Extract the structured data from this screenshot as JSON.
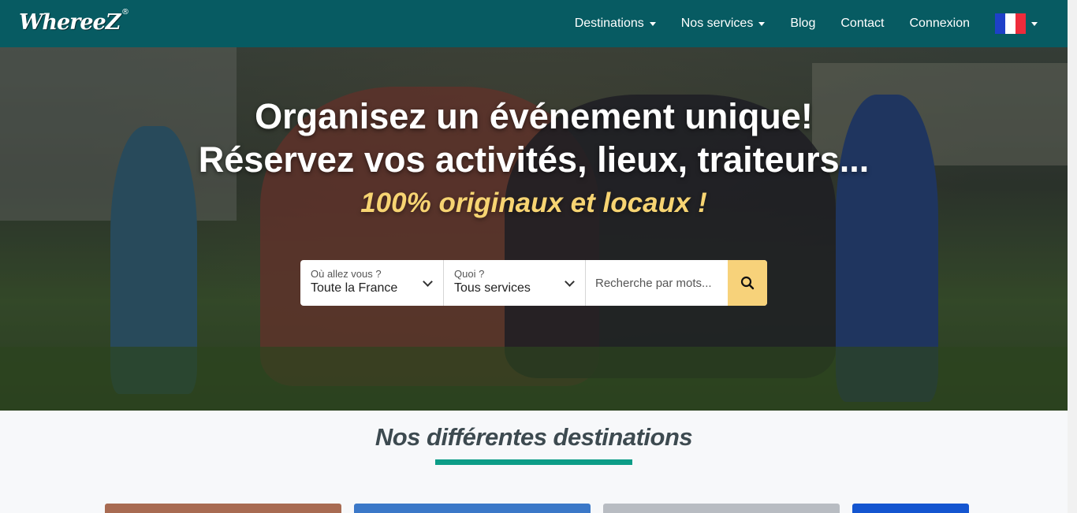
{
  "brand": {
    "logo_text": "WhereeZ",
    "registered": "®"
  },
  "nav": {
    "items": [
      {
        "label": "Destinations",
        "dropdown": true
      },
      {
        "label": "Nos services",
        "dropdown": true
      },
      {
        "label": "Blog",
        "dropdown": false
      },
      {
        "label": "Contact",
        "dropdown": false
      },
      {
        "label": "Connexion",
        "dropdown": false
      }
    ],
    "language_flag": "france-flag-icon"
  },
  "hero": {
    "title_line1": "Organisez un événement unique!",
    "title_line2": "Réservez vos activités, lieux, traiteurs...",
    "subtitle": "100% originaux et locaux !"
  },
  "search": {
    "where_label": "Où allez vous ?",
    "where_value": "Toute la France",
    "what_label": "Quoi ?",
    "what_value": "Tous services",
    "keyword_placeholder": "Recherche par mots...",
    "button_icon": "search-icon"
  },
  "destinations": {
    "title": "Nos différentes destinations"
  },
  "colors": {
    "navbar": "#075b62",
    "accent_yellow": "#f7d27a",
    "accent_teal": "#0c9d87",
    "flag_blue": "#1e40c8",
    "flag_red": "#ee2b3b"
  }
}
